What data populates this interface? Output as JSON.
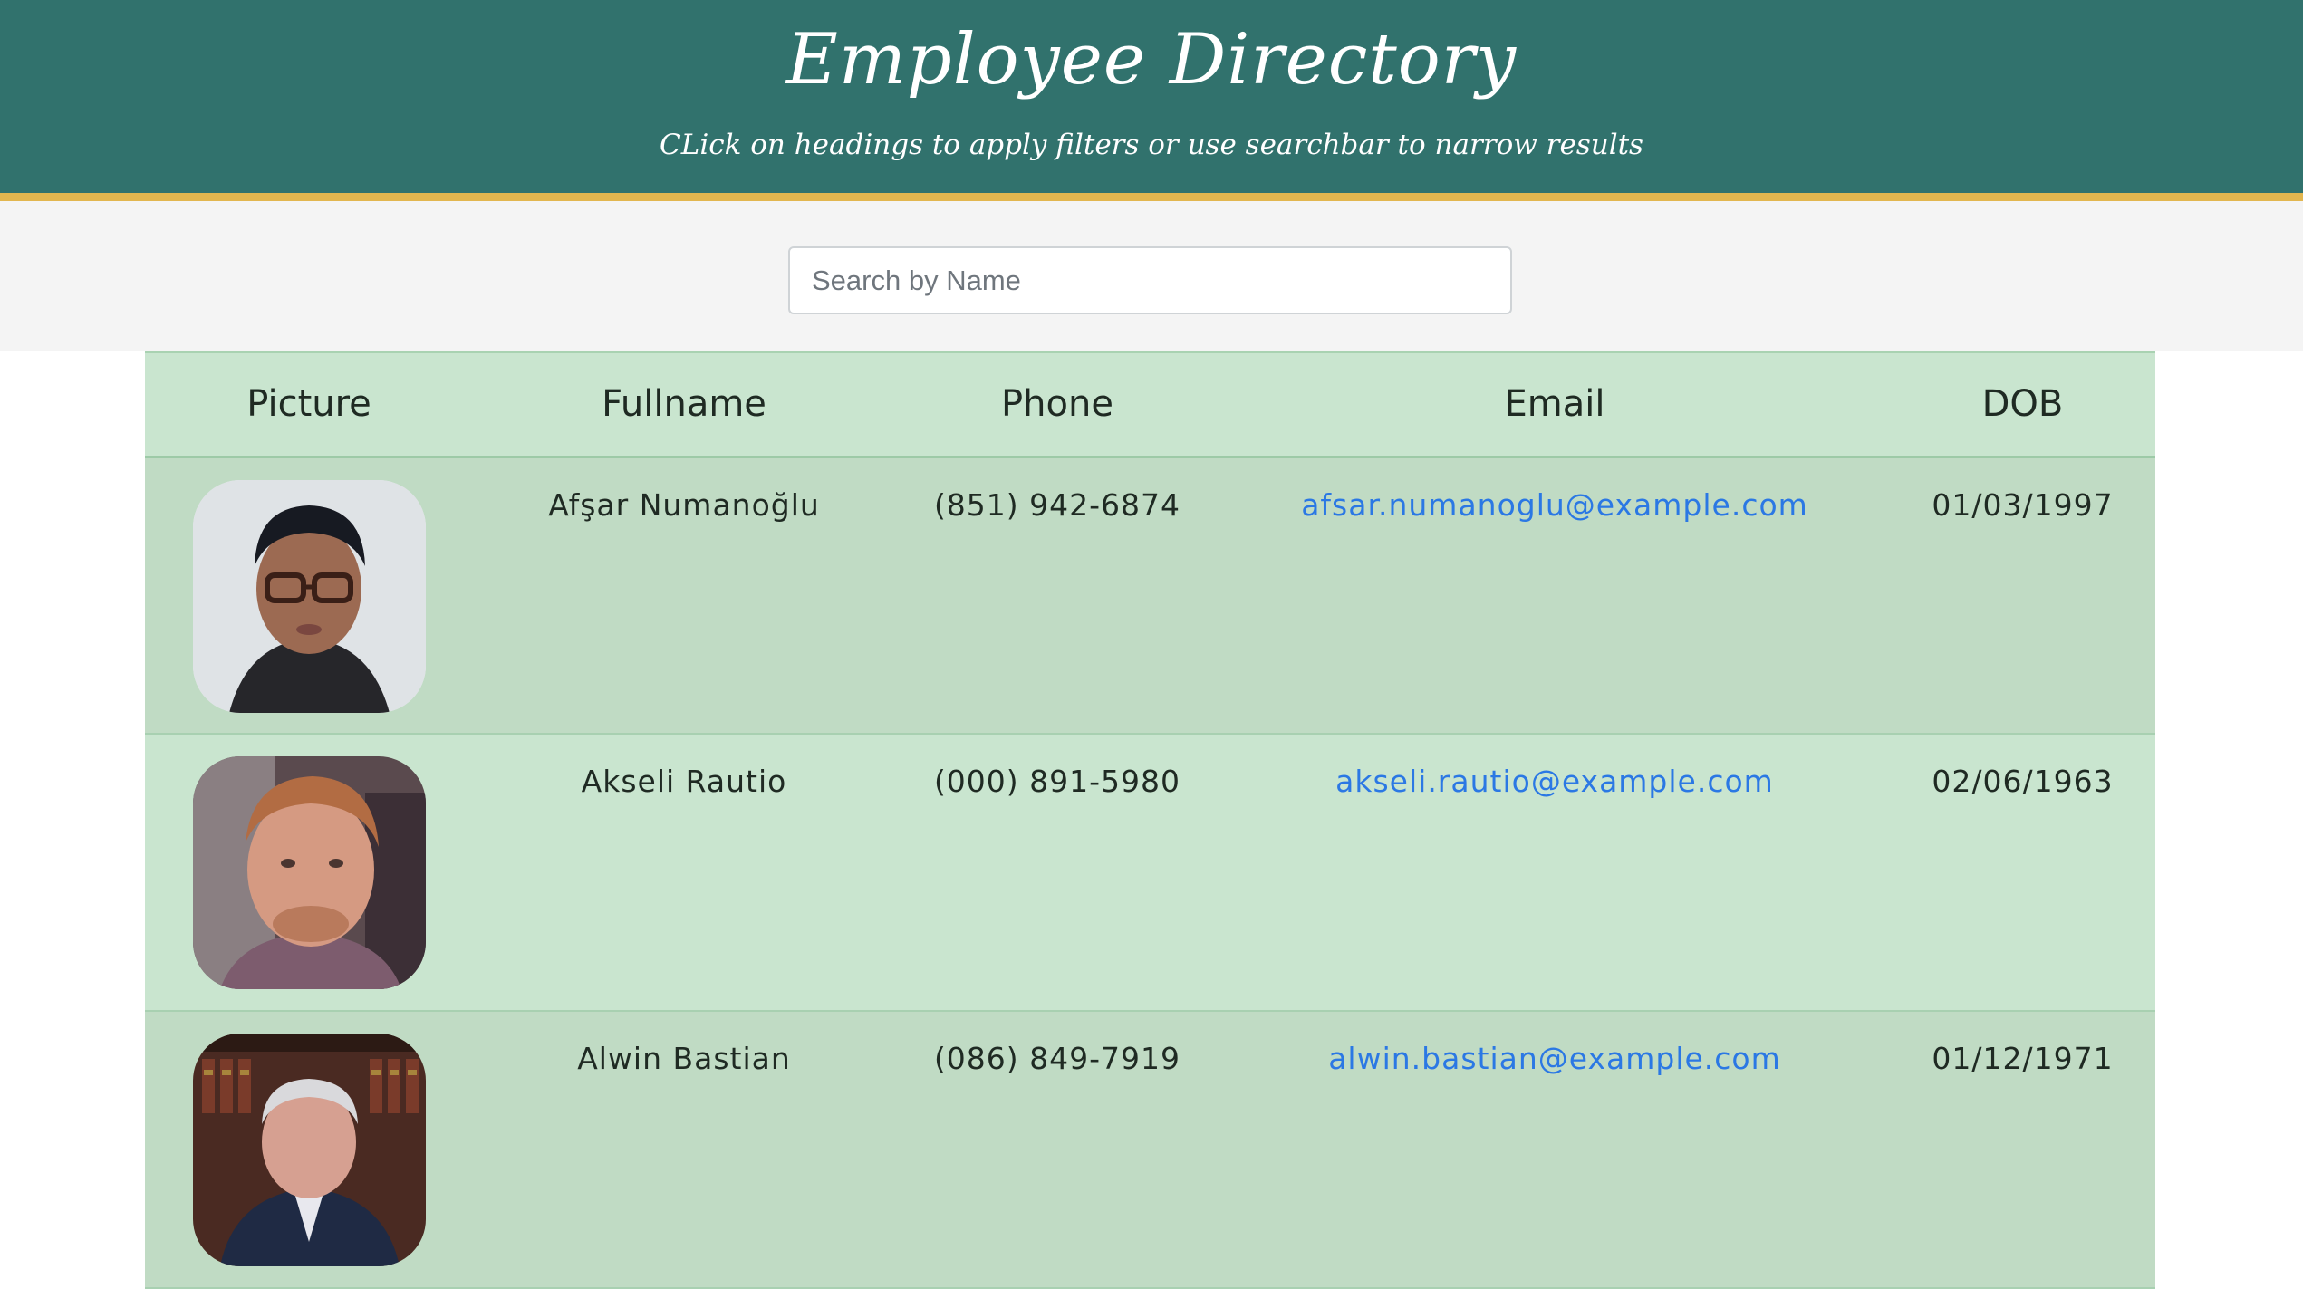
{
  "header": {
    "title": "Employee Directory",
    "subtitle": "CLick on headings to apply filters or use searchbar to narrow results"
  },
  "search": {
    "placeholder": "Search by Name",
    "value": ""
  },
  "table": {
    "columns": [
      "Picture",
      "Fullname",
      "Phone",
      "Email",
      "DOB"
    ],
    "rows": [
      {
        "name": "Afşar Numanoğlu",
        "phone": "(851) 942-6874",
        "email": "afsar.numanoglu@example.com",
        "dob": "01/03/1997"
      },
      {
        "name": "Akseli Rautio",
        "phone": "(000) 891-5980",
        "email": "akseli.rautio@example.com",
        "dob": "02/06/1963"
      },
      {
        "name": "Alwin Bastian",
        "phone": "(086) 849-7919",
        "email": "alwin.bastian@example.com",
        "dob": "01/12/1971"
      }
    ]
  },
  "colors": {
    "header_bg": "#31726d",
    "header_accent": "#e2b64f",
    "row_light": "#c9e5cf",
    "row_dark": "#c0dbc4",
    "link": "#2b78e4"
  }
}
